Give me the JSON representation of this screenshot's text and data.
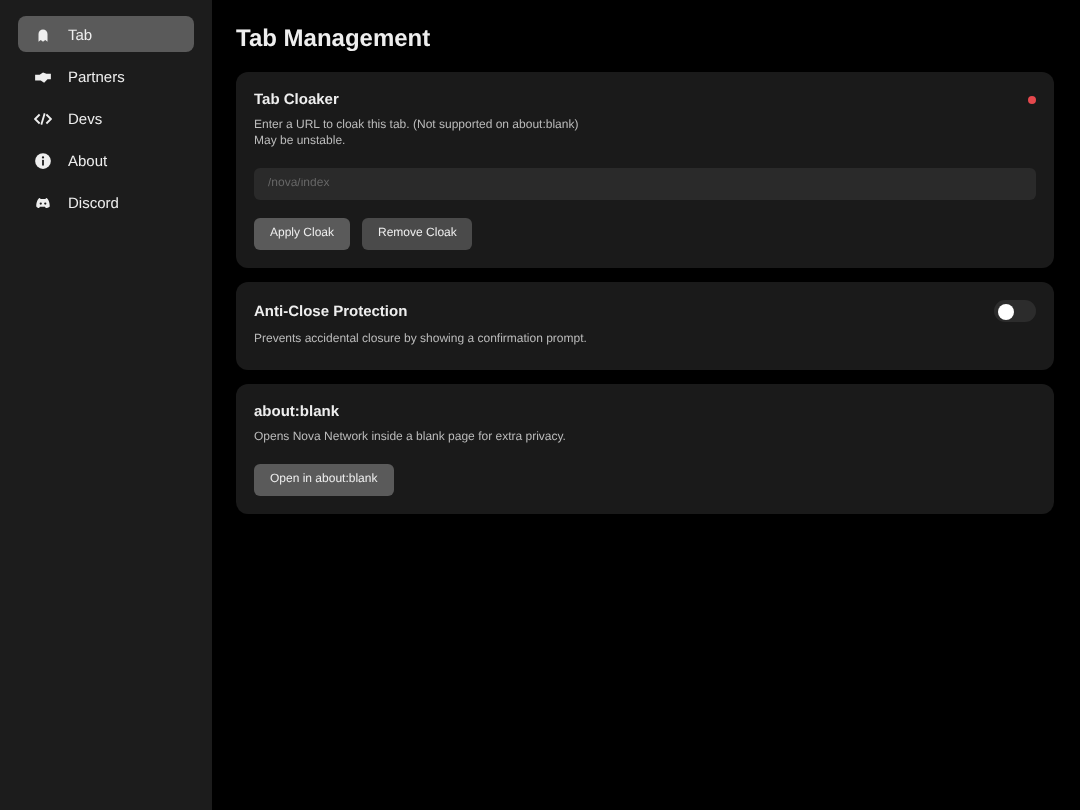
{
  "sidebar": {
    "items": [
      {
        "label": "Tab",
        "selected": true
      },
      {
        "label": "Partners",
        "selected": false
      },
      {
        "label": "Devs",
        "selected": false
      },
      {
        "label": "About",
        "selected": false
      },
      {
        "label": "Discord",
        "selected": false
      }
    ]
  },
  "page_title": "Tab Management",
  "cards": [
    {
      "kind": "cloaker",
      "title": "Tab Cloaker",
      "status_dot": {
        "color": "#e5484d"
      },
      "description": [
        "Enter a URL to cloak this tab. (Not supported on about:blank)",
        "May be unstable."
      ],
      "input": {
        "placeholder": "/nova/index"
      },
      "buttons": [
        "Apply Cloak",
        "Remove Cloak"
      ]
    },
    {
      "kind": "toggle",
      "title": "Anti-Close Protection",
      "description": [
        "Prevents accidental closure by showing a confirmation prompt."
      ],
      "on": false
    },
    {
      "kind": "action",
      "title": "about:blank",
      "description": [
        "Opens Nova Network inside a blank page for extra privacy."
      ],
      "buttons": [
        "Open in about:blank"
      ]
    }
  ]
}
